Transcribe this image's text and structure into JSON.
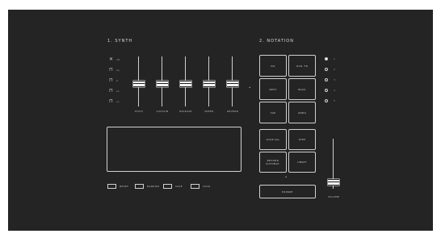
{
  "synth": {
    "title": "1. SYNTH",
    "waveforms": [
      {
        "icon": "sine-wave-icon",
        "glyph": "✕",
        "label": "off"
      },
      {
        "icon": "square-wave-icon",
        "glyph": "⊓",
        "label": "sq"
      },
      {
        "icon": "sawtooth-wave-icon",
        "glyph": "⊓",
        "label": "tr"
      },
      {
        "icon": "triangle-wave-icon",
        "glyph": "⊓",
        "label": "sa"
      },
      {
        "icon": "noise-wave-icon",
        "glyph": "⊓",
        "label": "sn"
      }
    ],
    "sliders": [
      {
        "label": "PITCH",
        "value": 0.45
      },
      {
        "label": "SUSTAIN",
        "value": 0.45
      },
      {
        "label": "RELEASE",
        "value": 0.45
      },
      {
        "label": "SPEED",
        "value": 0.45
      },
      {
        "label": "REVERB",
        "value": 0.45
      }
    ],
    "controls": [
      {
        "label": "RESET"
      },
      {
        "label": "RANDOM"
      },
      {
        "label": "SAVE"
      },
      {
        "label": "LOAD"
      }
    ]
  },
  "notation": {
    "title": "2. NOTATION",
    "buttons_grid": [
      [
        "DO",
        "OVR. FR"
      ],
      [
        "REST",
        "BACK"
      ],
      [
        "TAP",
        "UNDO"
      ]
    ],
    "buttons_lower": [
      [
        "LOOP ALL",
        "STEP"
      ],
      [
        "RECORD AUTOMAT.",
        "UNSET"
      ]
    ],
    "export_label": "EXPORT",
    "radios": [
      {
        "label": "1",
        "on": true
      },
      {
        "label": "2",
        "on": false
      },
      {
        "label": "3",
        "on": false
      },
      {
        "label": "4",
        "on": false
      },
      {
        "label": "5",
        "on": false
      }
    ],
    "volume": {
      "label": "VOLUME",
      "value": 0.2
    }
  }
}
